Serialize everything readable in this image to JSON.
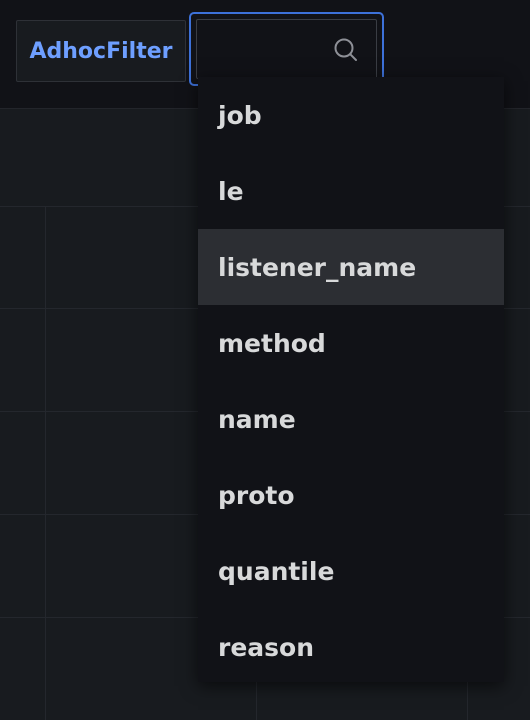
{
  "filter": {
    "label": "AdhocFilter"
  },
  "search": {
    "value": "",
    "placeholder": "",
    "icon": "search-icon"
  },
  "dropdown": {
    "highlighted_index": 2,
    "options": [
      {
        "label": "job"
      },
      {
        "label": "le"
      },
      {
        "label": "listener_name"
      },
      {
        "label": "method"
      },
      {
        "label": "name"
      },
      {
        "label": "proto"
      },
      {
        "label": "quantile"
      },
      {
        "label": "reason"
      }
    ]
  },
  "colors": {
    "background": "#111217",
    "panel": "#181b1f",
    "accent": "#3d71d9",
    "label_text": "#6e9fff",
    "option_text": "#d8d9da",
    "highlight": "#2c2e33"
  }
}
